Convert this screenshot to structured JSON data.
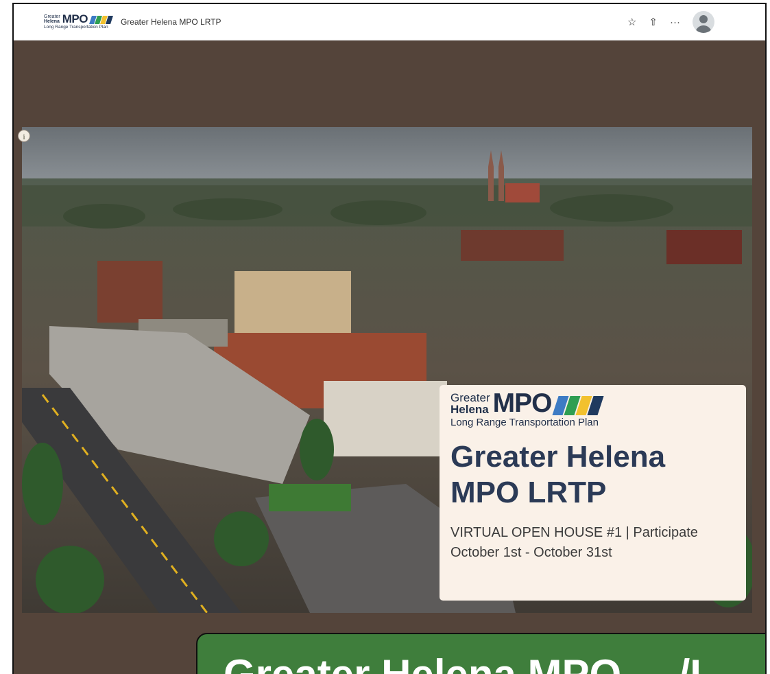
{
  "header": {
    "logo": {
      "line1": "Greater",
      "line2": "Helena",
      "wordmark": "MPO",
      "tagline": "Long Range Transportation Plan",
      "stripe_colors": [
        "#3d7bc4",
        "#2f9e52",
        "#f2c12e",
        "#1f3a5f"
      ]
    },
    "app_title": "Greater Helena MPO LRTP",
    "actions": {
      "favorite_glyph": "☆",
      "share_glyph": "⇧",
      "more_glyph": "···"
    },
    "avatar_icon": "user-avatar-icon"
  },
  "hero": {
    "info_glyph": "i",
    "image_description_icon": "aerial-city-photo",
    "card": {
      "logo": {
        "line1": "Greater",
        "line2": "Helena",
        "wordmark": "MPO",
        "tagline": "Long Range Transportation Plan"
      },
      "title": "Greater Helena MPO LRTP",
      "subtitle": "VIRTUAL OPEN HOUSE #1 | Participate October 1st - October 31st"
    }
  },
  "banner": {
    "text": "Greater Helena MPO ... /L"
  },
  "colors": {
    "page_background": "#54443a",
    "card_background": "#faf1e8",
    "title_color": "#2b3a56",
    "banner_green": "#3f7e3c"
  }
}
